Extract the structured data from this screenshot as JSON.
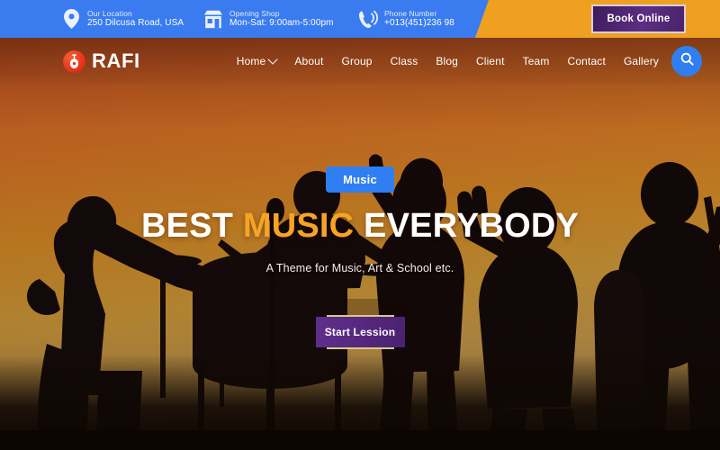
{
  "topbar": {
    "info": [
      {
        "icon": "location-pin-icon",
        "label": "Our Location",
        "value": "250 Dilcusa Road, USA"
      },
      {
        "icon": "shop-storefront-icon",
        "label": "Opening Shop",
        "value": "Mon-Sat: 9:00am-5:00pm"
      },
      {
        "icon": "phone-ringing-icon",
        "label": "Phone Number",
        "value": "+013(451)236 98"
      }
    ],
    "book_button": "Book Online",
    "colors": {
      "blue": "#3a7cf0",
      "orange": "#f0a020",
      "button_purple": "#4a2269"
    }
  },
  "nav": {
    "brand": "RAFI",
    "brand_icon": "guitar-icon",
    "items": [
      {
        "label": "Home",
        "has_dropdown": true
      },
      {
        "label": "About",
        "has_dropdown": false
      },
      {
        "label": "Group",
        "has_dropdown": false
      },
      {
        "label": "Class",
        "has_dropdown": false
      },
      {
        "label": "Blog",
        "has_dropdown": false
      },
      {
        "label": "Client",
        "has_dropdown": false
      },
      {
        "label": "Team",
        "has_dropdown": false
      },
      {
        "label": "Contact",
        "has_dropdown": false
      },
      {
        "label": "Gallery",
        "has_dropdown": false
      }
    ],
    "search_icon": "search-icon",
    "search_color": "#2f7ef2"
  },
  "hero": {
    "badge": "Music",
    "headline_part1": "BEST ",
    "headline_accent": "MUSIC",
    "headline_part2": " EVERYBODY",
    "subtitle": "A Theme for Music, Art & School etc.",
    "cta": "Start Lession",
    "accent_color": "#f5a425",
    "cta_color": "#56287f",
    "background": "silhouettes of a band performing against an orange sunset gradient"
  }
}
